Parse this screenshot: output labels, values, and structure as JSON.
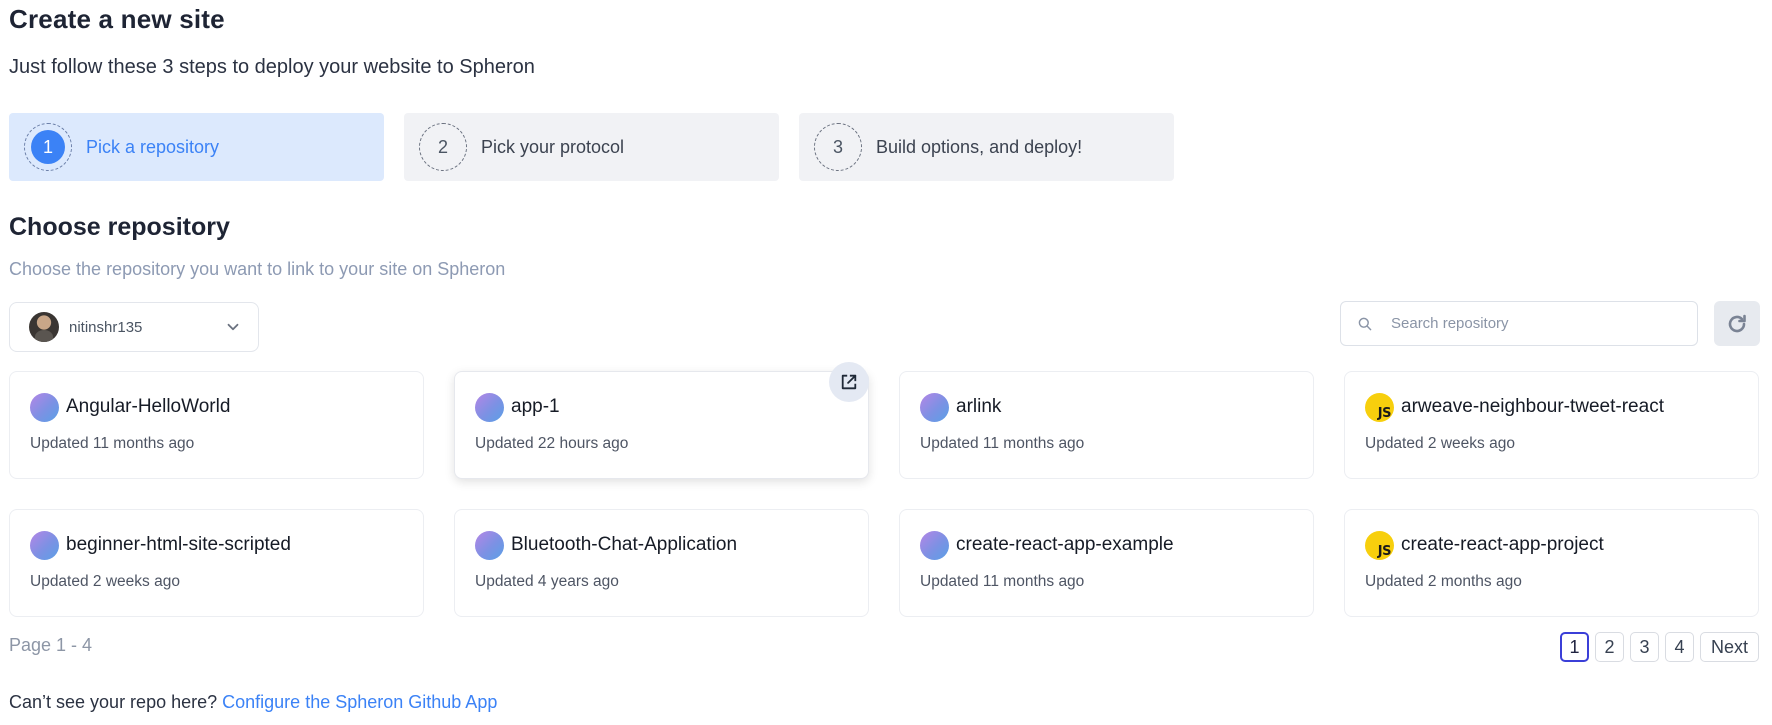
{
  "header": {
    "title": "Create a new site",
    "subtitle": "Just follow these 3 steps to deploy your website to Spheron"
  },
  "steps": [
    {
      "number": "1",
      "label": "Pick a repository",
      "active": true
    },
    {
      "number": "2",
      "label": "Pick your protocol",
      "active": false
    },
    {
      "number": "3",
      "label": "Build options, and deploy!",
      "active": false
    }
  ],
  "section": {
    "title": "Choose repository",
    "subtitle": "Choose the repository you want to link to your site on Spheron"
  },
  "account": {
    "username": "nitinshr135"
  },
  "search": {
    "placeholder": "Search repository",
    "value": ""
  },
  "repos": [
    {
      "name": "Angular-HelloWorld",
      "updated": "Updated 11 months ago",
      "icon": "gradient-repo-icon"
    },
    {
      "name": "app-1",
      "updated": "Updated 22 hours ago",
      "icon": "gradient-repo-icon"
    },
    {
      "name": "arlink",
      "updated": "Updated 11 months ago",
      "icon": "gradient-repo-icon"
    },
    {
      "name": "arweave-neighbour-tweet-react",
      "updated": "Updated 2 weeks ago",
      "icon": "javascript-icon"
    },
    {
      "name": "beginner-html-site-scripted",
      "updated": "Updated 2 weeks ago",
      "icon": "gradient-repo-icon"
    },
    {
      "name": "Bluetooth-Chat-Application",
      "updated": "Updated 4 years ago",
      "icon": "gradient-repo-icon"
    },
    {
      "name": "create-react-app-example",
      "updated": "Updated 11 months ago",
      "icon": "gradient-repo-icon"
    },
    {
      "name": "create-react-app-project",
      "updated": "Updated 2 months ago",
      "icon": "javascript-icon"
    }
  ],
  "js_badge": "JS",
  "pagination": {
    "info": "Page 1 - 4",
    "pages": [
      "1",
      "2",
      "3",
      "4"
    ],
    "current": "1",
    "next_label": "Next"
  },
  "footer": {
    "prompt": "Can’t see your repo here?",
    "link_label": "Configure the Spheron Github App"
  },
  "colors": {
    "accent": "#3b82f6",
    "active_step_bg": "#dce9fd",
    "js_yellow": "#f7cf0d"
  }
}
